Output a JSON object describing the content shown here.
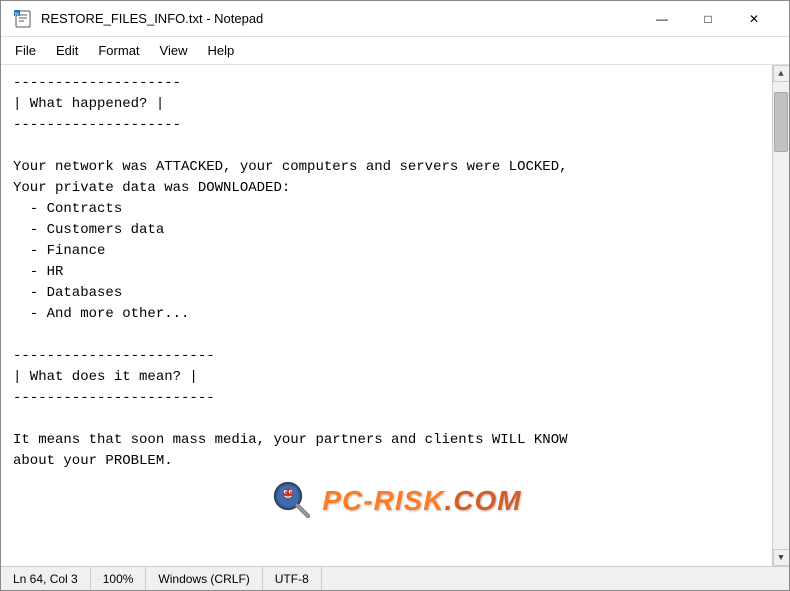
{
  "window": {
    "title": "RESTORE_FILES_INFO.txt - Notepad",
    "icon": "📄"
  },
  "titlebar": {
    "minimize_label": "—",
    "maximize_label": "□",
    "close_label": "✕"
  },
  "menubar": {
    "items": [
      "File",
      "Edit",
      "Format",
      "View",
      "Help"
    ]
  },
  "content": {
    "text": "--------------------\n| What happened? |\n--------------------\n\nYour network was ATTACKED, your computers and servers were LOCKED,\nYour private data was DOWNLOADED:\n  - Contracts\n  - Customers data\n  - Finance\n  - HR\n  - Databases\n  - And more other...\n\n------------------------\n| What does it mean? |\n------------------------\n\nIt means that soon mass media, your partners and clients WILL KNOW\nabout your PROBLEM."
  },
  "statusbar": {
    "line_col": "Ln 64, Col 3",
    "zoom": "100%",
    "line_ending": "Windows (CRLF)",
    "encoding": "UTF-8"
  },
  "watermark": {
    "text": "PC-RISK.COM"
  }
}
